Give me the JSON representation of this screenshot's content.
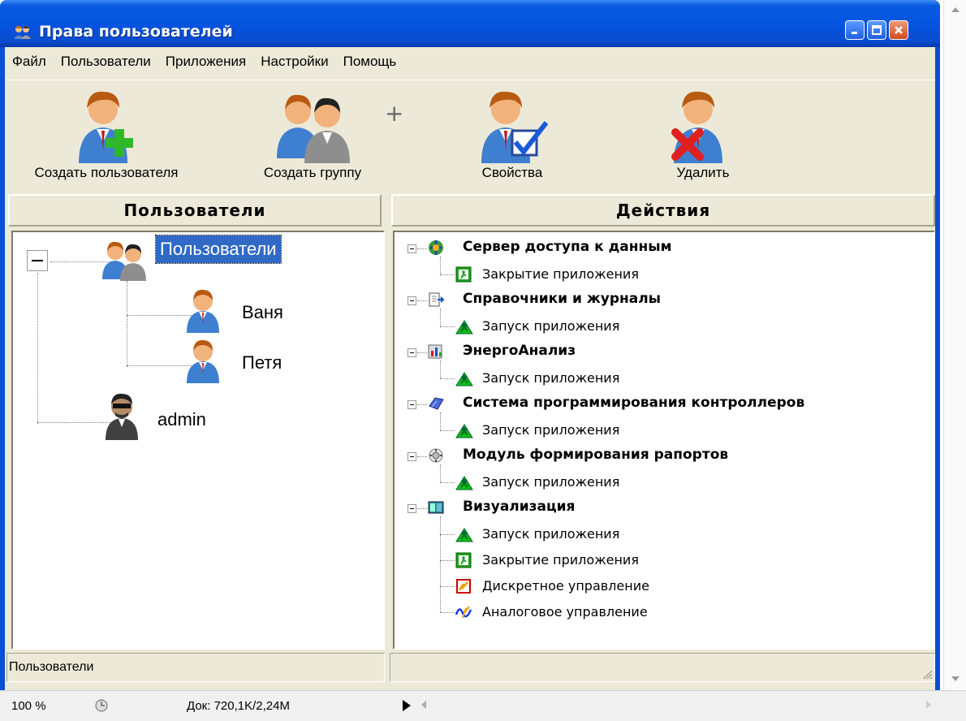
{
  "window": {
    "title": "Права пользователей"
  },
  "menu": [
    "Файл",
    "Пользователи",
    "Приложения",
    "Настройки",
    "Помощь"
  ],
  "toolbar": {
    "create_user": "Создать пользователя",
    "create_group": "Создать группу",
    "properties": "Свойства",
    "delete": "Удалить"
  },
  "left_panel": {
    "header": "Пользователи",
    "root": "Пользователи",
    "children": [
      "Ваня",
      "Петя"
    ],
    "admin": "admin",
    "status": "Пользователи"
  },
  "right_panel": {
    "header": "Действия",
    "groups": [
      {
        "name": "Сервер доступа к данным",
        "items": [
          "Закрытие приложения"
        ]
      },
      {
        "name": "Справочники и журналы",
        "items": [
          "Запуск приложения"
        ]
      },
      {
        "name": "ЭнергоАнализ",
        "items": [
          "Запуск приложения"
        ]
      },
      {
        "name": "Система программирования контроллеров",
        "items": [
          "Запуск приложения"
        ]
      },
      {
        "name": "Модуль формирования рапортов",
        "items": [
          "Запуск приложения"
        ]
      },
      {
        "name": "Визуализация",
        "items": [
          "Запуск приложения",
          "Закрытие приложения",
          "Дискретное управление",
          "Аналоговое управление"
        ]
      }
    ]
  },
  "browser": {
    "zoom": "100 %",
    "doc": "Док: 720,1K/2,24M"
  },
  "colors": {
    "titlebar": "#0a5ae0",
    "selection": "#316ac5",
    "face": "#ece9d8"
  }
}
